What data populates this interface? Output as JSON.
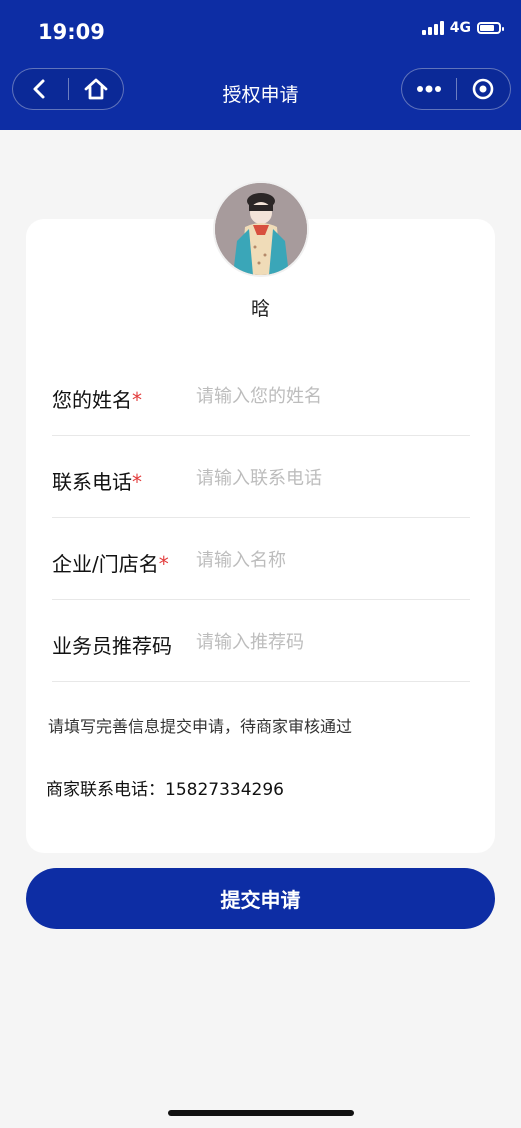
{
  "status_bar": {
    "time": "19:09",
    "network": "4G"
  },
  "nav": {
    "title": "授权申请",
    "icons": [
      "back-icon",
      "home-icon",
      "more-icon",
      "target-icon"
    ]
  },
  "profile": {
    "name": "晗"
  },
  "form": {
    "fields": [
      {
        "label": "您的姓名",
        "required": "*",
        "placeholder": "请输入您的姓名"
      },
      {
        "label": "联系电话",
        "required": "*",
        "placeholder": "请输入联系电话"
      },
      {
        "label": "企业/门店名",
        "required": "*",
        "placeholder": "请输入名称"
      },
      {
        "label": "业务员推荐码",
        "required": "",
        "placeholder": "请输入推荐码"
      }
    ]
  },
  "note": "请填写完善信息提交申请，待商家审核通过",
  "merchant_phone": "商家联系电话：15827334296",
  "submit_label": "提交申请",
  "colors": {
    "primary": "#0d2da4",
    "required": "#e23b3b",
    "background": "#f5f5f5"
  }
}
